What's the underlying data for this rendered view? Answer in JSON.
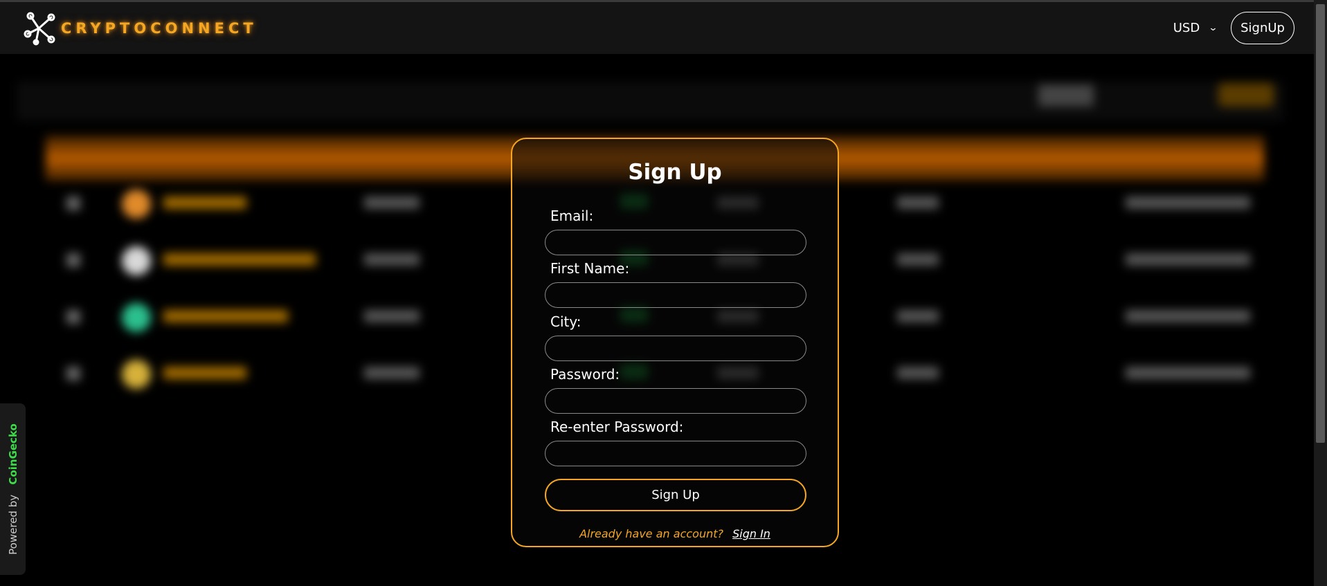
{
  "header": {
    "brand": "CRYPTOCONNECT",
    "currency": "USD",
    "signup_label": "SignUp"
  },
  "powered_by": {
    "prefix": "Powered by",
    "provider": "CoinGecko"
  },
  "modal": {
    "title": "Sign Up",
    "fields": [
      {
        "label": "Email:",
        "value": ""
      },
      {
        "label": "First Name:",
        "value": ""
      },
      {
        "label": "City:",
        "value": ""
      },
      {
        "label": "Password:",
        "value": ""
      },
      {
        "label": "Re-enter Password:",
        "value": ""
      }
    ],
    "submit_label": "Sign Up",
    "signin_prompt": "Already have an account?",
    "signin_link": "Sign In"
  },
  "colors": {
    "accent": "#f5a623",
    "background": "#000000",
    "nav": "#141414",
    "gecko_green": "#3ddc4a"
  }
}
